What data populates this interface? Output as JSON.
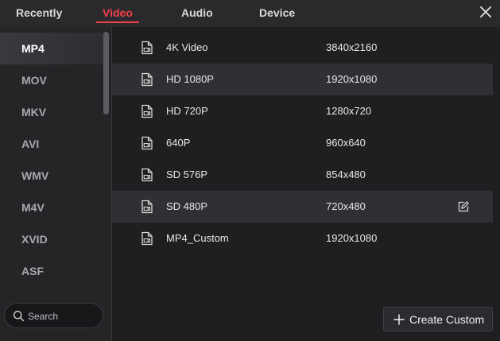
{
  "tabs": [
    {
      "label": "Recently",
      "active": false
    },
    {
      "label": "Video",
      "active": true
    },
    {
      "label": "Audio",
      "active": false
    },
    {
      "label": "Device",
      "active": false
    }
  ],
  "accent_color": "#f0404a",
  "formats": [
    "MP4",
    "MOV",
    "MKV",
    "AVI",
    "WMV",
    "M4V",
    "XVID",
    "ASF"
  ],
  "selected_format": "MP4",
  "search": {
    "placeholder": "Search",
    "value": ""
  },
  "presets": [
    {
      "name": "4K Video",
      "resolution": "3840x2160"
    },
    {
      "name": "HD 1080P",
      "resolution": "1920x1080"
    },
    {
      "name": "HD 720P",
      "resolution": "1280x720"
    },
    {
      "name": "640P",
      "resolution": "960x640"
    },
    {
      "name": "SD 576P",
      "resolution": "854x480"
    },
    {
      "name": "SD 480P",
      "resolution": "720x480"
    },
    {
      "name": "MP4_Custom",
      "resolution": "1920x1080"
    }
  ],
  "hovered_preset": "SD 480P",
  "create_custom_label": "Create Custom",
  "icons": {
    "close": "close-icon",
    "search": "search-icon",
    "preset": "video-file-icon",
    "edit": "edit-icon",
    "add": "plus-icon"
  }
}
